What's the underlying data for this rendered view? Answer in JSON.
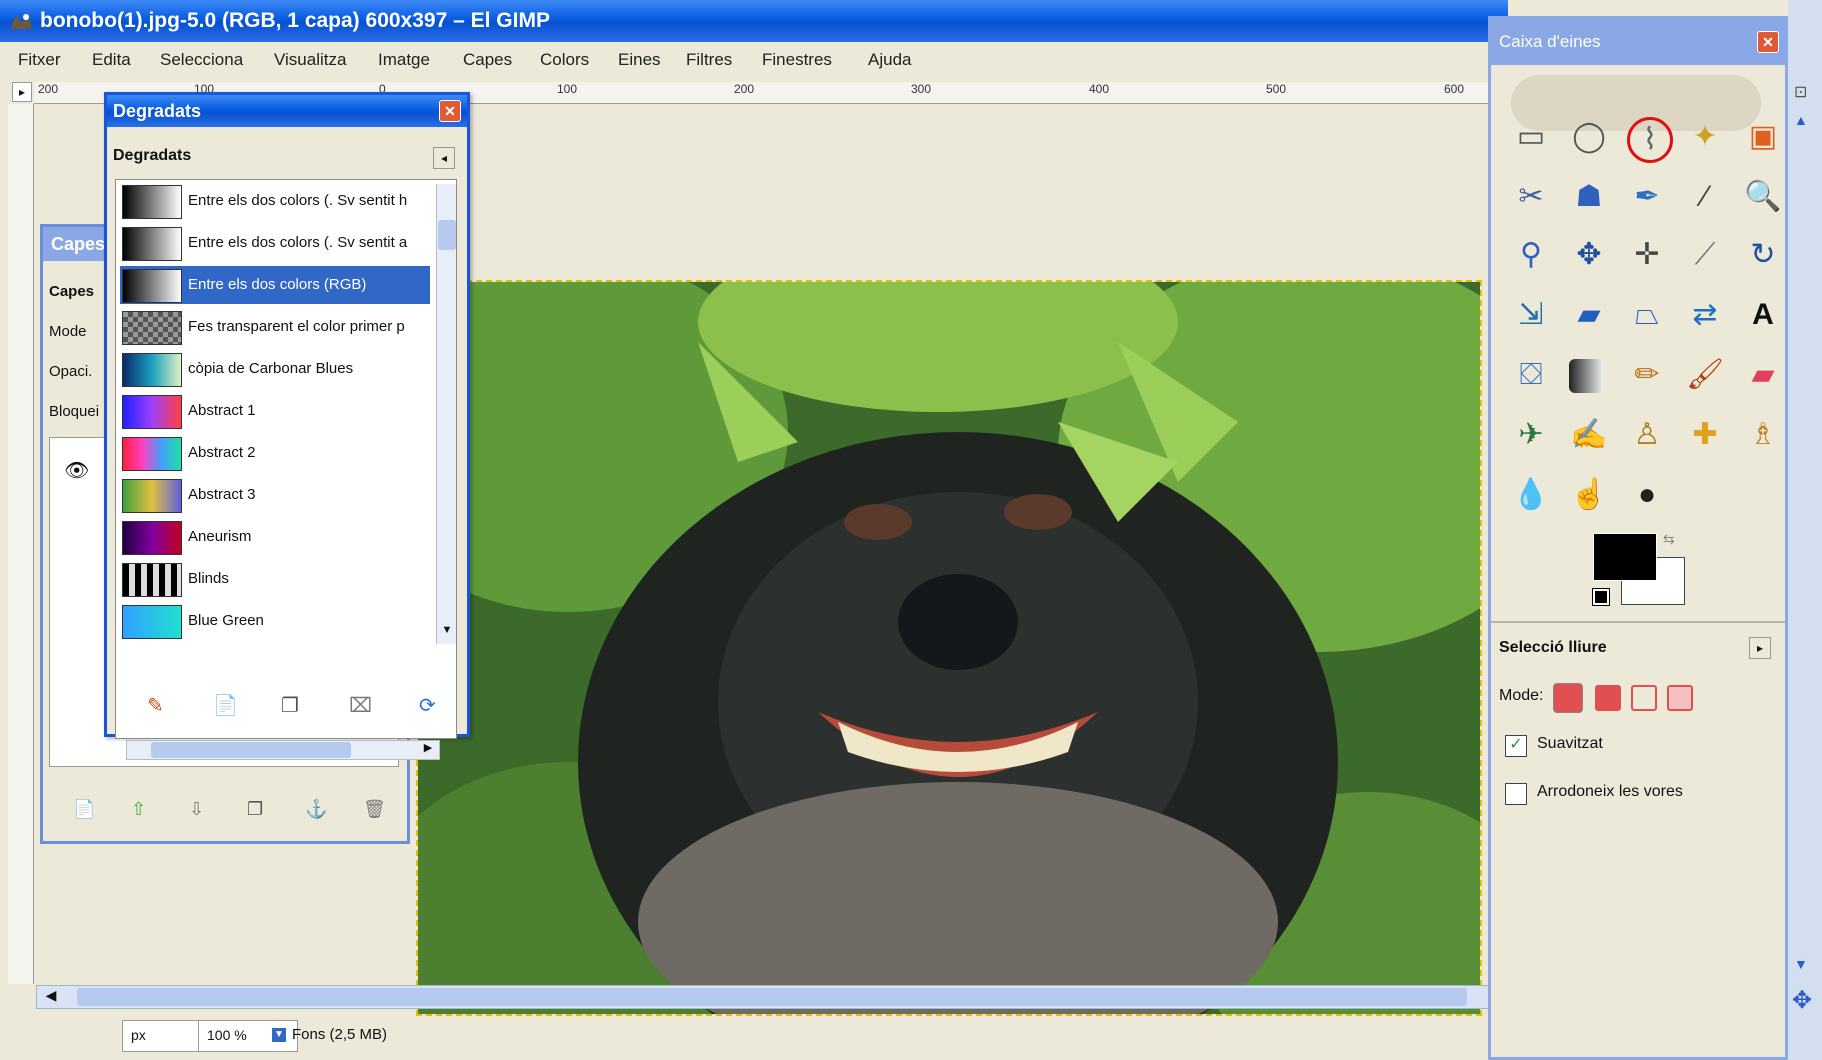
{
  "window": {
    "title": "bonobo(1).jpg-5.0 (RGB, 1 capa) 600x397 – El GIMP"
  },
  "menubar": [
    "Fitxer",
    "Edita",
    "Selecciona",
    "Visualitza",
    "Imatge",
    "Capes",
    "Colors",
    "Eines",
    "Filtres",
    "Finestres",
    "Ajuda"
  ],
  "ruler_top": [
    "200",
    "100",
    "0",
    "100",
    "200",
    "300",
    "400",
    "500",
    "600"
  ],
  "status": {
    "unit": "px",
    "zoom": "100 %",
    "info": "Fons (2,5 MB)"
  },
  "layers_dialog": {
    "title": "Capes",
    "sub": "Capes",
    "mode_label": "Mode",
    "opacity_label": "Opaci.",
    "lock_label": "Bloquei"
  },
  "gradients_dialog": {
    "title": "Degradats",
    "subtitle": "Degradats",
    "items": [
      "Entre els dos colors (. Sv sentit h",
      "Entre els dos colors (. Sv sentit a",
      "Entre els dos colors (RGB)",
      "Fes transparent el color primer p",
      "còpia de Carbonar Blues",
      "Abstract 1",
      "Abstract 2",
      "Abstract 3",
      "Aneurism",
      "Blinds",
      "Blue Green"
    ],
    "selected_index": 2
  },
  "toolbox": {
    "title": "Caixa d'eines",
    "tools": [
      "rect-select",
      "ellipse-select",
      "free-select",
      "fuzzy-select",
      "by-color-select",
      "scissors",
      "foreground-select",
      "paths",
      "color-picker",
      "magnify",
      "measure",
      "move",
      "align",
      "crop",
      "rotate",
      "scale",
      "shear",
      "perspective",
      "flip",
      "text",
      "bucket-fill",
      "blend",
      "pencil",
      "paintbrush",
      "eraser",
      "airbrush",
      "ink",
      "clone",
      "heal",
      "perspective-clone",
      "blur",
      "smudge",
      "dodge-burn"
    ],
    "highlighted_tool": "free-select",
    "fg_color": "#000000",
    "bg_color": "#ffffff",
    "options_title": "Selecció lliure",
    "mode_label": "Mode:",
    "antialias_label": "Suavitzat",
    "feather_label": "Arrodoneix les vores"
  }
}
